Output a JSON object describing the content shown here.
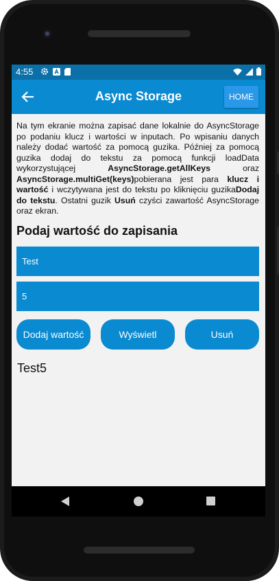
{
  "status_bar": {
    "time": "4:55"
  },
  "app_bar": {
    "title": "Async Storage",
    "home_label": "HOME"
  },
  "description": {
    "t1": "Na tym ekranie można zapisać dane lokalnie do AsyncStorage po podaniu klucz i wartości w inputach. Po wpisaniu danych należy dodać wartość za pomocą guzika. Później za pomocą guzika dodaj do tekstu za pomocą funkcji loadData wykorzystującej ",
    "b1": "AsyncStorage.getAllKeys",
    "t2": " oraz ",
    "b2": "AsyncStorage.multiGet(keys)",
    "t3": "pobierana jest para ",
    "b3": "klucz i wartość",
    "t4": " i wczytywana jest do tekstu po kliknięciu guzika",
    "b4": "Dodaj do tekstu",
    "t5": ". Ostatni guzik ",
    "b5": "Usuń",
    "t6": " czyści zawartość AsyncStorage oraz ekran."
  },
  "form": {
    "heading": "Podaj wartość do zapisania",
    "key_value": "Test",
    "value_value": "5"
  },
  "buttons": {
    "add": "Dodaj wartość",
    "show": "Wyświetl",
    "remove": "Usuń"
  },
  "result_text": "Test5"
}
